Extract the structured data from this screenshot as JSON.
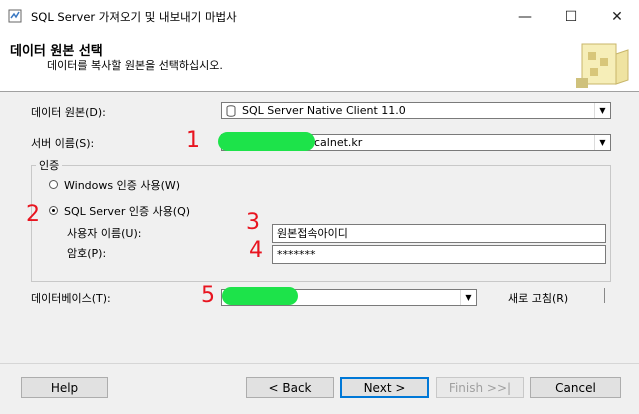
{
  "window": {
    "title": "SQL Server 가져오기 및 내보내기 마법사",
    "minimize_glyph": "—",
    "maximize_glyph": "☐",
    "close_glyph": "✕"
  },
  "header": {
    "title": "데이터 원본 선택",
    "subtitle": "데이터를 복사할 원본을 선택하십시오."
  },
  "form": {
    "data_source_label": "데이터 원본(D):",
    "data_source_value": "SQL Server Native Client 11.0",
    "server_name_label": "서버 이름(S):",
    "server_name_value": "calnet.kr",
    "auth_group_label": "인증",
    "windows_auth_label": "Windows 인증 사용(W)",
    "sql_auth_label": "SQL Server 인증 사용(Q)",
    "username_label": "사용자 이름(U):",
    "username_value": "원본접속아이디",
    "password_label": "암호(P):",
    "password_value": "*******",
    "database_label": "데이터베이스(T):",
    "refresh_label": "새로 고침(R)",
    "selected_auth": "sql"
  },
  "buttons": {
    "help": "Help",
    "back": "< Back",
    "next": "Next >",
    "finish": "Finish >>|",
    "cancel": "Cancel"
  },
  "annotations": {
    "mark_1": "1",
    "mark_2": "2",
    "mark_3": "3",
    "mark_4": "4",
    "mark_5": "5",
    "mark_color": "#e8141f",
    "highlight_color": "#1de34a"
  }
}
